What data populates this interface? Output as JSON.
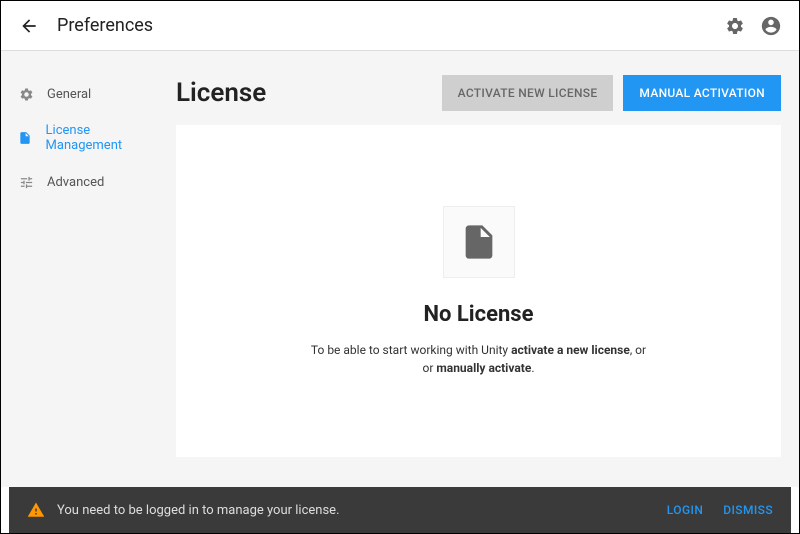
{
  "header": {
    "title": "Preferences"
  },
  "sidebar": {
    "items": [
      {
        "label": "General"
      },
      {
        "label": "License Management"
      },
      {
        "label": "Advanced"
      }
    ]
  },
  "main": {
    "title": "License",
    "activate_btn": "ACTIVATE NEW LICENSE",
    "manual_btn": "MANUAL ACTIVATION",
    "empty": {
      "heading": "No License",
      "desc_prefix": "To be able to start working with Unity ",
      "desc_bold1": "activate a new license",
      "desc_mid": ", or ",
      "desc_bold2": "manually activate",
      "desc_suffix": "."
    }
  },
  "footer": {
    "message": "You need to be logged in to manage your license.",
    "login": "LOGIN",
    "dismiss": "DISMISS"
  }
}
